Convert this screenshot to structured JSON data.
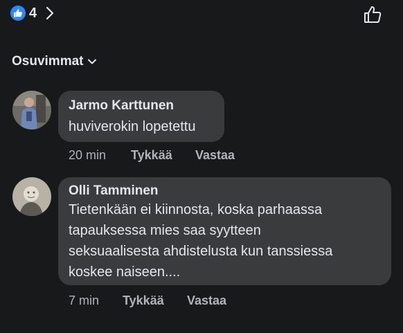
{
  "header": {
    "reaction_count": "4",
    "icons": {
      "reaction": "like-filled-icon",
      "more": "chevron-right-icon",
      "like_action": "thumbs-up-outline-icon"
    }
  },
  "sort": {
    "label": "Osuvimmat",
    "icon": "chevron-down-icon"
  },
  "comments": [
    {
      "author": "Jarmo Karttunen",
      "text": "huviverokin lopetettu",
      "time": "20 min",
      "like_label": "Tykkää",
      "reply_label": "Vastaa"
    },
    {
      "author": "Olli Tamminen",
      "text": "Tietenkään ei kiinnosta, koska parhaassa\ntapauksessa mies saa syytteen\nseksuaalisesta ahdistelusta kun tanssiessa\nkoskee naiseen....",
      "time": "7 min",
      "like_label": "Tykkää",
      "reply_label": "Vastaa"
    }
  ],
  "colors": {
    "background": "#18191a",
    "bubble": "#3a3b3c",
    "primary_text": "#e4e6eb",
    "secondary_text": "#b0b3b8",
    "accent": "#2d88ff"
  }
}
